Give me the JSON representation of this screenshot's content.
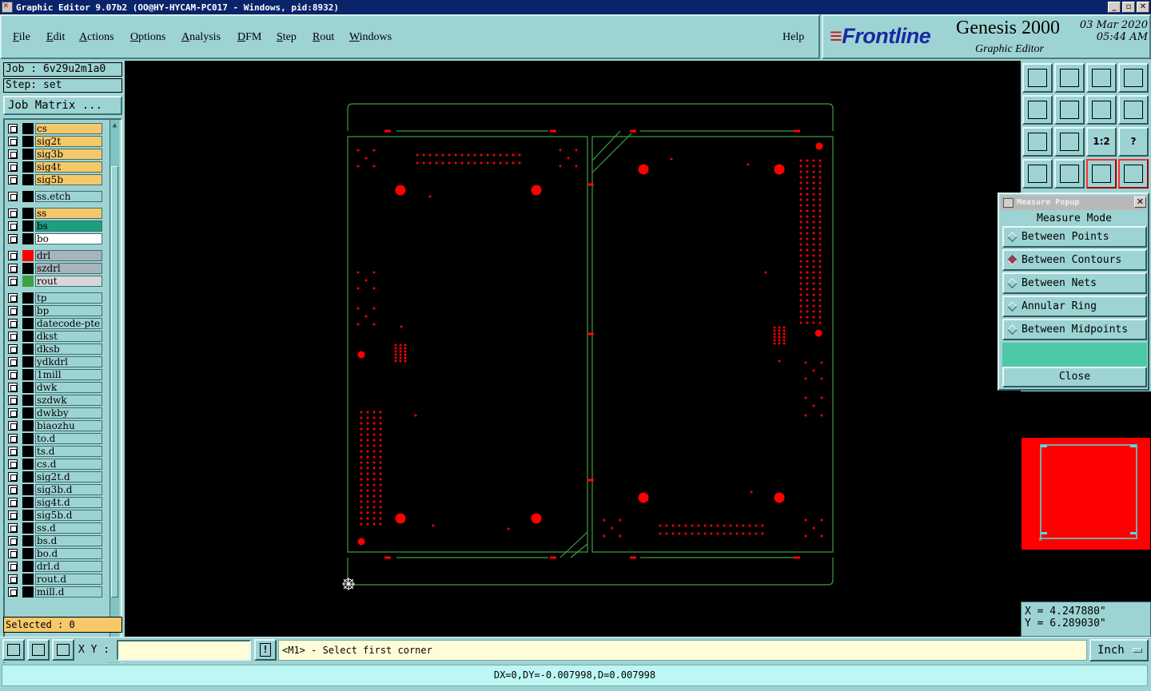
{
  "window": {
    "title": "Graphic Editor 9.07b2 (OO@HY-HYCAM-PC017 - Windows, pid:8932)",
    "buttons": [
      "_",
      "▫",
      "✕"
    ]
  },
  "menu": {
    "items": [
      {
        "label": "File",
        "ul": "F",
        "rest": "ile"
      },
      {
        "label": "Edit",
        "ul": "E",
        "rest": "dit"
      },
      {
        "label": "Actions",
        "ul": "A",
        "rest": "ctions"
      },
      {
        "label": "Options",
        "ul": "O",
        "rest": "ptions"
      },
      {
        "label": "Analysis",
        "ul": "A",
        "rest": "nalysis"
      },
      {
        "label": "DFM",
        "ul": "D",
        "rest": "FM"
      },
      {
        "label": "Step",
        "ul": "S",
        "rest": "tep"
      },
      {
        "label": "Rout",
        "ul": "R",
        "rest": "out"
      },
      {
        "label": "Windows",
        "ul": "W",
        "rest": "indows"
      }
    ],
    "help": "Help"
  },
  "brand": {
    "logo": "Frontline",
    "product": "Genesis 2000",
    "subtitle": "Graphic Editor",
    "date": "03 Mar 2020",
    "time": "05:44 AM"
  },
  "job": {
    "job_label": "Job : 6v29u2m1a0",
    "step_label": "Step: set",
    "matrix_button": "Job Matrix ...",
    "selected": "Selected : 0"
  },
  "layers": [
    {
      "name": "cs",
      "color": "#f5c86a",
      "swatch": "#000"
    },
    {
      "name": "sig2t",
      "color": "#f5c86a",
      "swatch": "#000"
    },
    {
      "name": "sig3b",
      "color": "#f5c86a",
      "swatch": "#000"
    },
    {
      "name": "sig4t",
      "color": "#f5c86a",
      "swatch": "#000"
    },
    {
      "name": "sig5b",
      "color": "#f5c86a",
      "swatch": "#000"
    },
    {
      "name": "ss.etch",
      "color": "#9ed3d3",
      "swatch": "#000"
    },
    {
      "name": "ss",
      "color": "#f5c86a",
      "swatch": "#000"
    },
    {
      "name": "bs",
      "color": "#1e9e80",
      "swatch": "#000"
    },
    {
      "name": "bo",
      "color": "#ffffff",
      "swatch": "#000"
    },
    {
      "name": "drl",
      "color": "#a8b4bc",
      "swatch": "#ff0000"
    },
    {
      "name": "szdrl",
      "color": "#a8b4bc",
      "swatch": "#000"
    },
    {
      "name": "rout",
      "color": "#d8d8d8",
      "swatch": "#3fa040"
    },
    {
      "name": "tp",
      "color": "#9ed3d3",
      "swatch": "#000"
    },
    {
      "name": "bp",
      "color": "#9ed3d3",
      "swatch": "#000"
    },
    {
      "name": "datecode-pte",
      "color": "#9ed3d3",
      "swatch": "#000"
    },
    {
      "name": "dkst",
      "color": "#9ed3d3",
      "swatch": "#000"
    },
    {
      "name": "dksb",
      "color": "#9ed3d3",
      "swatch": "#000"
    },
    {
      "name": "ydkdrl",
      "color": "#9ed3d3",
      "swatch": "#000"
    },
    {
      "name": "1mill",
      "color": "#9ed3d3",
      "swatch": "#000"
    },
    {
      "name": "dwk",
      "color": "#9ed3d3",
      "swatch": "#000"
    },
    {
      "name": "szdwk",
      "color": "#9ed3d3",
      "swatch": "#000"
    },
    {
      "name": "dwkby",
      "color": "#9ed3d3",
      "swatch": "#000"
    },
    {
      "name": "biaozhu",
      "color": "#9ed3d3",
      "swatch": "#000"
    },
    {
      "name": "to.d",
      "color": "#9ed3d3",
      "swatch": "#000"
    },
    {
      "name": "ts.d",
      "color": "#9ed3d3",
      "swatch": "#000"
    },
    {
      "name": "cs.d",
      "color": "#9ed3d3",
      "swatch": "#000"
    },
    {
      "name": "sig2t.d",
      "color": "#9ed3d3",
      "swatch": "#000"
    },
    {
      "name": "sig3b.d",
      "color": "#9ed3d3",
      "swatch": "#000"
    },
    {
      "name": "sig4t.d",
      "color": "#9ed3d3",
      "swatch": "#000"
    },
    {
      "name": "sig5b.d",
      "color": "#9ed3d3",
      "swatch": "#000"
    },
    {
      "name": "ss.d",
      "color": "#9ed3d3",
      "swatch": "#000"
    },
    {
      "name": "bs.d",
      "color": "#9ed3d3",
      "swatch": "#000"
    },
    {
      "name": "bo.d",
      "color": "#9ed3d3",
      "swatch": "#000"
    },
    {
      "name": "drl.d",
      "color": "#9ed3d3",
      "swatch": "#000"
    },
    {
      "name": "rout.d",
      "color": "#9ed3d3",
      "swatch": "#000"
    },
    {
      "name": "mill.d",
      "color": "#9ed3d3",
      "swatch": "#000"
    }
  ],
  "toolbar_icons": [
    "zoom-home-icon",
    "zoom-down-icon",
    "home-icon",
    "split-icon",
    "pan-left-icon",
    "pan-right-icon",
    "undo-zoom-icon",
    "snap-icon",
    "fit-icon",
    "center-icon",
    "scale-1to2-icon",
    "help-icon",
    "tools-icon",
    "measure-icon",
    "net-red-icon",
    "net-red2-icon"
  ],
  "toolbar_labels": [
    "",
    "",
    "",
    "",
    "",
    "",
    "",
    "",
    "",
    "",
    "1:2",
    "?",
    "",
    "",
    "",
    ""
  ],
  "measure": {
    "title": "Measure Popup",
    "header": "Measure Mode",
    "options": [
      {
        "label": "Between Points",
        "selected": false
      },
      {
        "label": "Between Contours",
        "selected": true
      },
      {
        "label": "Between Nets",
        "selected": false
      },
      {
        "label": "Annular Ring",
        "selected": false
      },
      {
        "label": "Between Midpoints",
        "selected": false
      }
    ],
    "close": "Close"
  },
  "coords": {
    "x": "X = 4.247880\"",
    "y": "Y = 6.289030\""
  },
  "bottom": {
    "xy_label": "X Y :",
    "xy_value": "",
    "alert": "!",
    "prompt": "<M1> - Select first corner",
    "units": "Inch"
  },
  "status": {
    "text": "DX=0,DY=-0.007998,D=0.007998"
  },
  "colors": {
    "board_outline": "#3fa040",
    "drill": "#ff0000",
    "canvas_bg": "#000000",
    "panel_bg": "#9ed3d3"
  }
}
